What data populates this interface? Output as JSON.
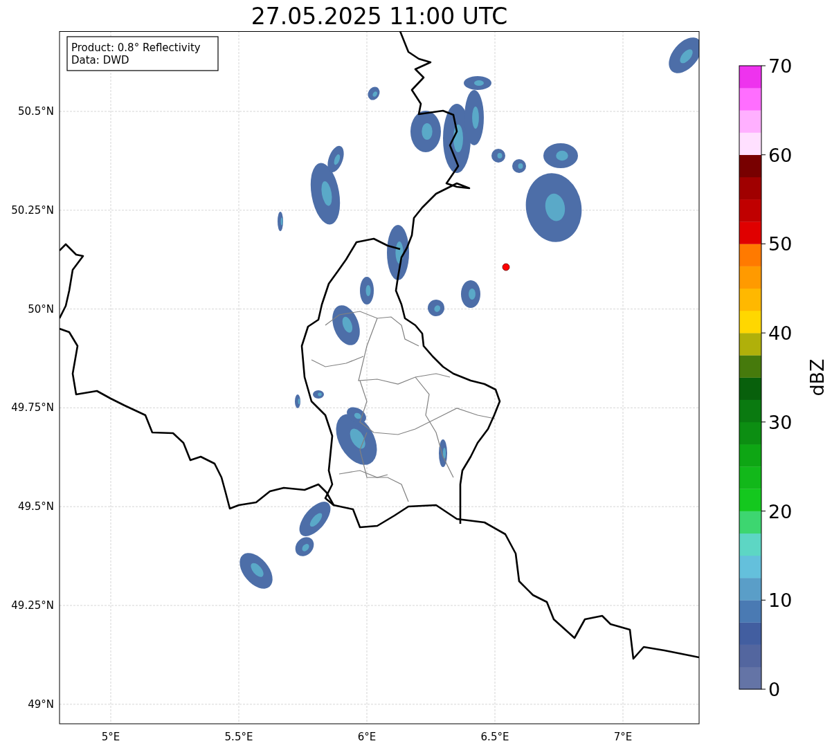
{
  "title": "27.05.2025 11:00 UTC",
  "info_box": {
    "lines": [
      "Product: 0.8° Reflectivity",
      "Data: DWD"
    ]
  },
  "map": {
    "lat_labels": [
      "50.5°N",
      "50.25°N",
      "50°N",
      "49.75°N",
      "49.5°N",
      "49.25°N",
      "49°N"
    ],
    "lon_labels": [
      "5°E",
      "5.5°E",
      "6°E",
      "6.5°E",
      "7°E"
    ],
    "marker": {
      "color": "#ff0000"
    }
  },
  "colorbar": {
    "label": "dBZ",
    "ticks": [
      "70",
      "60",
      "50",
      "40",
      "30",
      "20",
      "10",
      "0"
    ],
    "bins": [
      {
        "color": "#6474a6"
      },
      {
        "color": "#53669f"
      },
      {
        "color": "#425ea0"
      },
      {
        "color": "#4a7ab3"
      },
      {
        "color": "#5a9ec8"
      },
      {
        "color": "#64c0dc"
      },
      {
        "color": "#5dd6c4"
      },
      {
        "color": "#3dd670"
      },
      {
        "color": "#14c81e"
      },
      {
        "color": "#12b81a"
      },
      {
        "color": "#0ea614"
      },
      {
        "color": "#0c8e12"
      },
      {
        "color": "#0a7a10"
      },
      {
        "color": "#08600c"
      },
      {
        "color": "#467a0c"
      },
      {
        "color": "#b0b00a"
      },
      {
        "color": "#ffd700"
      },
      {
        "color": "#ffb800"
      },
      {
        "color": "#ff9a00"
      },
      {
        "color": "#ff7a00"
      },
      {
        "color": "#e00000"
      },
      {
        "color": "#c00000"
      },
      {
        "color": "#a00000"
      },
      {
        "color": "#780000"
      },
      {
        "color": "#ffe0ff"
      },
      {
        "color": "#ffb0ff"
      },
      {
        "color": "#ff6eff"
      },
      {
        "color": "#ee33ee"
      }
    ]
  }
}
